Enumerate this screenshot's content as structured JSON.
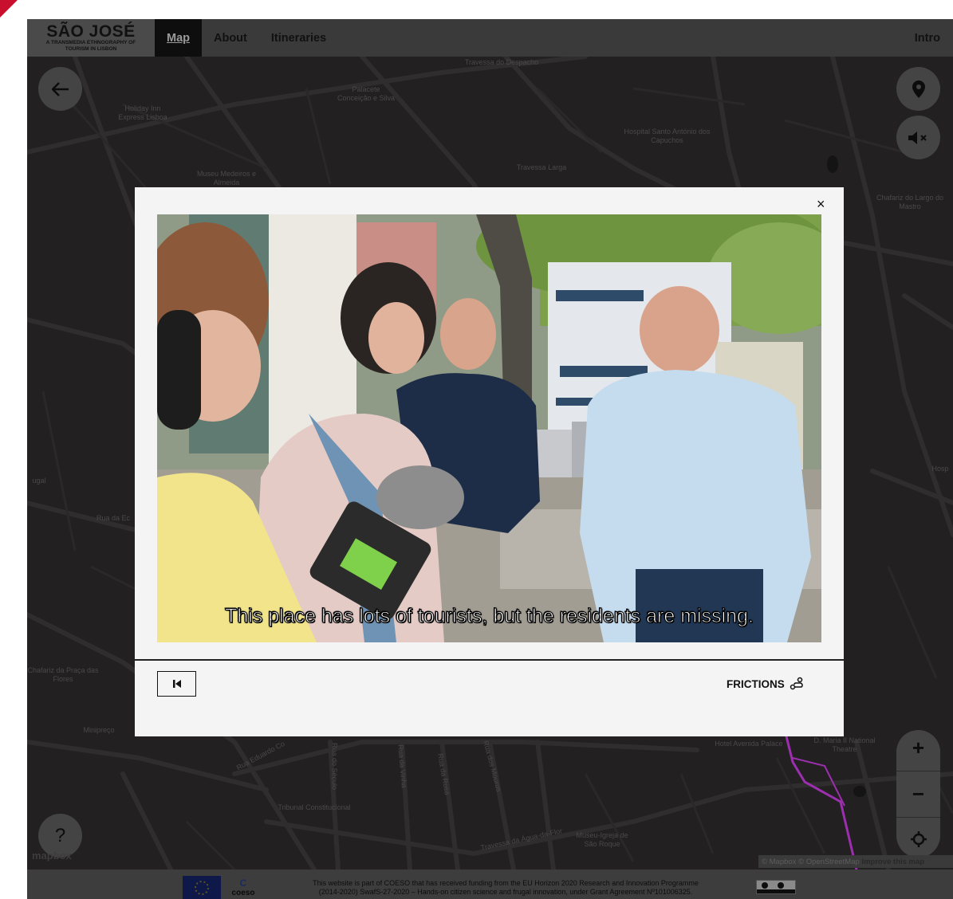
{
  "nav": {
    "logo_title": "SÃO JOSÉ",
    "logo_subtitle": "A TRANSMEDIA ETHNOGRAPHY OF TOURISM IN LISBON",
    "links": [
      "Map",
      "About",
      "Itineraries"
    ],
    "intro": "Intro"
  },
  "map": {
    "labels": {
      "palacete": "Palacete Conceição e Silva",
      "holiday_inn": "Holiday Inn Express Lisboa",
      "hospital": "Hospital Santo António dos Capuchos",
      "museu_medeiros": "Museu Medeiros e Almeida",
      "travessa_despacho": "Travessa do Despacho",
      "travessa_larga": "Travessa Larga",
      "chafariz_mastro": "Chafariz do Largo do Mastro",
      "rua_da_ec": "Rua da Ec",
      "chafariz_flores": "Chafariz da Praça das Flores",
      "minipreco": "Minipreço",
      "tribunal": "Tribunal Constitucional",
      "hotel_avenida": "Hotel Avenida Palace",
      "teatro": "D. Maria II National Theatre",
      "museu_igreja": "Museu-Igreja de São Roque",
      "travessa_agua": "Travessa da Água-da-Flor",
      "rua_eduardo": "Rua Eduardo Co",
      "rua_do_seculo": "Rua do Século",
      "rua_da_rosa": "Rua da Rosa",
      "rua_vinha": "Rua da Vinha",
      "rua_mouros": "Rua dos Mouros",
      "hosp": "Hosp",
      "ugal": "ugal"
    },
    "buttons": {
      "back_icon": "arrow-left-icon",
      "pin_icon": "map-pin-icon",
      "mute_icon": "speaker-muted-icon",
      "help": "?",
      "zoom_in": "+",
      "zoom_out": "−",
      "locate_icon": "crosshair-icon"
    },
    "mapbox_logo": "mapbox",
    "attribution": {
      "mapbox": "© Mapbox",
      "osm": "© OpenStreetMap",
      "improve": "Improve this map"
    }
  },
  "modal": {
    "close": "×",
    "subtitle": "This place has lots of tourists, but the residents are missing.",
    "restart_icon": "skip-back-icon",
    "tag_label": "FRICTIONS",
    "tag_icon": "route-icon"
  },
  "footer": {
    "coeso": "coeso",
    "text_line1": "This website is part of COESO that has received funding from the EU Horizon 2020 Research and Innovation Programme",
    "text_line2": "(2014-2020) SwafS-27-2020 – Hands-on citizen science and frugal innovation, under Grant Agreement Nº101006325.",
    "license": "cc by-sa"
  },
  "colors": {
    "accent": "#c8102e",
    "route": "#9b2fae",
    "map_bg": "#222021",
    "nav_bg": "#3a3a3a"
  }
}
